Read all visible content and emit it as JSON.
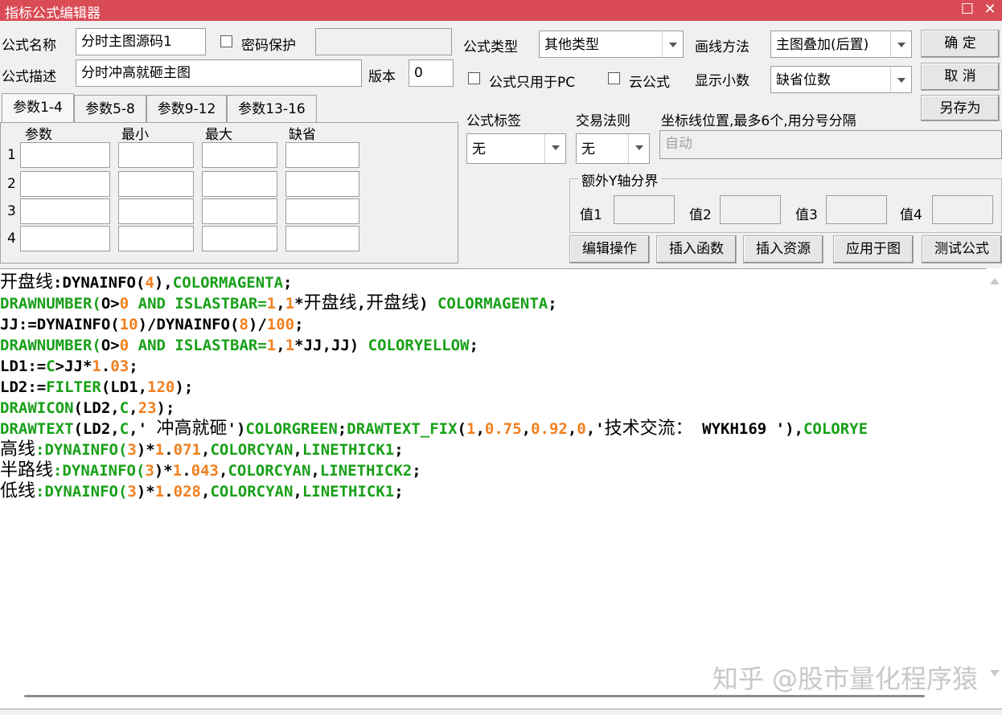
{
  "window": {
    "title": "指标公式编辑器",
    "restore_glyph": "☐",
    "close_glyph": "✕"
  },
  "form": {
    "name_label": "公式名称",
    "name_value": "分时主图源码1",
    "password_label": "密码保护",
    "password_value": "",
    "desc_label": "公式描述",
    "desc_value": "分时冲高就砸主图",
    "version_label": "版本",
    "version_value": "0",
    "type_label": "公式类型",
    "type_value": "其他类型",
    "draw_method_label": "画线方法",
    "draw_method_value": "主图叠加(后置)",
    "pc_only_label": "公式只用于PC",
    "cloud_label": "云公式",
    "decimals_label": "显示小数",
    "decimals_value": "缺省位数",
    "tag_label": "公式标签",
    "tag_value": "无",
    "rule_label": "交易法则",
    "rule_value": "无",
    "axis_label": "坐标线位置,最多6个,用分号分隔",
    "axis_value": "自动",
    "extra_y_label": "额外Y轴分界",
    "y_values": [
      "值1",
      "值2",
      "值3",
      "值4"
    ]
  },
  "buttons": {
    "ok": "确  定",
    "cancel": "取  消",
    "save_as": "另存为",
    "edit_ops": "编辑操作",
    "insert_func": "插入函数",
    "insert_res": "插入资源",
    "apply": "应用于图",
    "test": "测试公式"
  },
  "tabs": [
    "参数1-4",
    "参数5-8",
    "参数9-12",
    "参数13-16"
  ],
  "params": {
    "headers": [
      "参数",
      "最小",
      "最大",
      "缺省"
    ],
    "rows": [
      "1",
      "2",
      "3",
      "4"
    ]
  },
  "code_lines": [
    [
      [
        "开盘线",
        "cn"
      ],
      [
        ":DYNAINFO(",
        "black"
      ],
      [
        "4",
        "orange"
      ],
      [
        "),",
        "black"
      ],
      [
        "COLORMAGENTA",
        "green"
      ],
      [
        ";",
        "black"
      ]
    ],
    [
      [
        "DRAWNUMBER(",
        "green"
      ],
      [
        "O>",
        "black"
      ],
      [
        "0",
        "orange"
      ],
      [
        " AND ISLASTBAR=",
        "green"
      ],
      [
        "1",
        "orange"
      ],
      [
        ",",
        "black"
      ],
      [
        "1",
        "orange"
      ],
      [
        "*",
        "black"
      ],
      [
        "开盘线",
        "cn"
      ],
      [
        ",",
        "black"
      ],
      [
        "开盘线",
        "cn"
      ],
      [
        ") ",
        "black"
      ],
      [
        "COLORMAGENTA",
        "green"
      ],
      [
        ";",
        "black"
      ]
    ],
    [
      [
        "JJ:=DYNAINFO(",
        "black"
      ],
      [
        "10",
        "orange"
      ],
      [
        ")/DYNAINFO(",
        "black"
      ],
      [
        "8",
        "orange"
      ],
      [
        ")/",
        "black"
      ],
      [
        "100",
        "orange"
      ],
      [
        ";",
        "black"
      ]
    ],
    [
      [
        "DRAWNUMBER(",
        "green"
      ],
      [
        "O>",
        "black"
      ],
      [
        "0",
        "orange"
      ],
      [
        " AND ISLASTBAR=",
        "green"
      ],
      [
        "1",
        "orange"
      ],
      [
        ",",
        "black"
      ],
      [
        "1",
        "orange"
      ],
      [
        "*JJ,JJ) ",
        "black"
      ],
      [
        "COLORYELLOW",
        "green"
      ],
      [
        ";",
        "black"
      ]
    ],
    [
      [
        "LD1:=",
        "black"
      ],
      [
        "C",
        "green"
      ],
      [
        ">JJ*",
        "black"
      ],
      [
        "1",
        "orange"
      ],
      [
        ".",
        "black"
      ],
      [
        "03",
        "orange"
      ],
      [
        ";",
        "black"
      ]
    ],
    [
      [
        "LD2:=",
        "black"
      ],
      [
        "FILTER",
        "green"
      ],
      [
        "(LD1,",
        "black"
      ],
      [
        "120",
        "orange"
      ],
      [
        ");",
        "black"
      ]
    ],
    [
      [
        "DRAWICON",
        "green"
      ],
      [
        "(LD2,",
        "black"
      ],
      [
        "C",
        "green"
      ],
      [
        ",",
        "black"
      ],
      [
        "23",
        "orange"
      ],
      [
        ");",
        "black"
      ]
    ],
    [
      [
        "DRAWTEXT",
        "green"
      ],
      [
        "(LD2,",
        "black"
      ],
      [
        "C",
        "green"
      ],
      [
        ",' ",
        "black"
      ],
      [
        "冲高就砸",
        "cn"
      ],
      [
        "')",
        "black"
      ],
      [
        "COLORGREEN",
        "green"
      ],
      [
        ";",
        "black"
      ],
      [
        "DRAWTEXT_FIX",
        "green"
      ],
      [
        "(",
        "black"
      ],
      [
        "1",
        "orange"
      ],
      [
        ",",
        "black"
      ],
      [
        "0.75",
        "orange"
      ],
      [
        ",",
        "black"
      ],
      [
        "0.92",
        "orange"
      ],
      [
        ",",
        "black"
      ],
      [
        "0",
        "orange"
      ],
      [
        ",'",
        "black"
      ],
      [
        "技术交流：",
        "cn"
      ],
      [
        " WYKH169 '),",
        "black"
      ],
      [
        "COLORYE",
        "green"
      ]
    ],
    [
      [
        "高线",
        "cn"
      ],
      [
        ":DYNAINFO(",
        "green"
      ],
      [
        "3",
        "orange"
      ],
      [
        ")*",
        "black"
      ],
      [
        "1",
        "orange"
      ],
      [
        ".",
        "black"
      ],
      [
        "071",
        "orange"
      ],
      [
        ",",
        "black"
      ],
      [
        "COLORCYAN",
        "green"
      ],
      [
        ",",
        "black"
      ],
      [
        "LINETHICK1",
        "green"
      ],
      [
        ";",
        "black"
      ]
    ],
    [
      [
        "半路线",
        "cn"
      ],
      [
        ":DYNAINFO(",
        "green"
      ],
      [
        "3",
        "orange"
      ],
      [
        ")*",
        "black"
      ],
      [
        "1",
        "orange"
      ],
      [
        ".",
        "black"
      ],
      [
        "043",
        "orange"
      ],
      [
        ",",
        "black"
      ],
      [
        "COLORCYAN",
        "green"
      ],
      [
        ",",
        "black"
      ],
      [
        "LINETHICK2",
        "green"
      ],
      [
        ";",
        "black"
      ]
    ],
    [
      [
        "低线",
        "cn"
      ],
      [
        ":DYNAINFO(",
        "green"
      ],
      [
        "3",
        "orange"
      ],
      [
        ")*",
        "black"
      ],
      [
        "1",
        "orange"
      ],
      [
        ".",
        "black"
      ],
      [
        "028",
        "orange"
      ],
      [
        ",",
        "black"
      ],
      [
        "COLORCYAN",
        "green"
      ],
      [
        ",",
        "black"
      ],
      [
        "LINETHICK1",
        "green"
      ],
      [
        ";",
        "black"
      ]
    ]
  ],
  "watermark": "知乎 @股市量化程序猿",
  "colors": {
    "titlebar": "#d94b55",
    "code_green": "#18a018",
    "code_orange": "#f08020"
  }
}
